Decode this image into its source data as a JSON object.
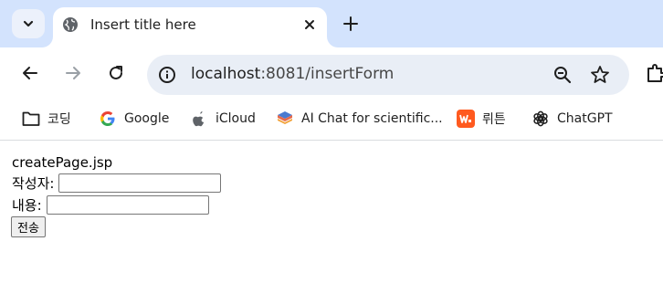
{
  "tab": {
    "title": "Insert title here"
  },
  "address_bar": {
    "host": "localhost",
    "rest": ":8081/insertForm"
  },
  "bookmarks": [
    {
      "label": "코딩",
      "icon": "folder-icon"
    },
    {
      "label": "Google",
      "icon": "google-icon"
    },
    {
      "label": "iCloud",
      "icon": "apple-icon"
    },
    {
      "label": "AI Chat for scientific...",
      "icon": "scispace-icon"
    },
    {
      "label": "뤼튼",
      "icon": "wrtn-icon"
    },
    {
      "label": "ChatGPT",
      "icon": "chatgpt-icon"
    }
  ],
  "page": {
    "heading": "createPage.jsp",
    "writer_label": "작성자:",
    "writer_value": "",
    "content_label": "내용:",
    "content_value": "",
    "submit_label": "전송"
  },
  "colors": {
    "tabstrip": "#d3e3fd",
    "omnibox": "#e9eef6",
    "wrtn_brand": "#ff5a1f"
  }
}
